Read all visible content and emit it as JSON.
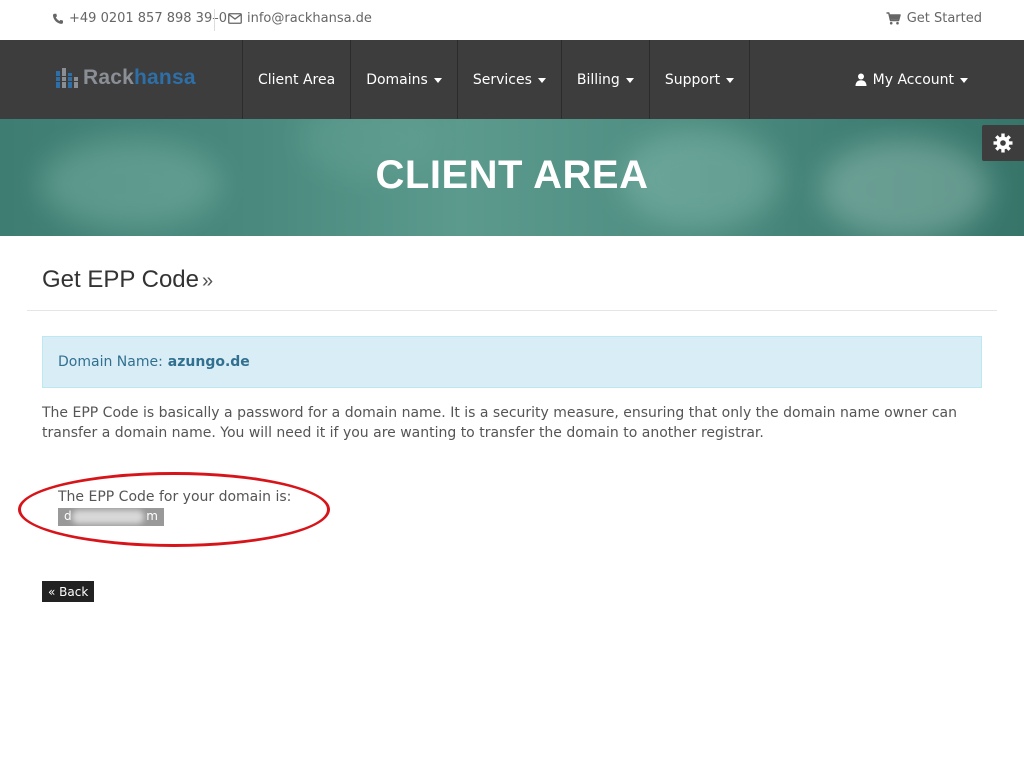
{
  "topbar": {
    "phone": "+49 0201 857 898 39–0",
    "email": "info@rackhansa.de",
    "get_started": "Get Started"
  },
  "logo": {
    "part1": "Rack",
    "part2": "hansa"
  },
  "nav": {
    "items": [
      {
        "label": "Client Area",
        "dropdown": false
      },
      {
        "label": "Domains",
        "dropdown": true
      },
      {
        "label": "Services",
        "dropdown": true
      },
      {
        "label": "Billing",
        "dropdown": true
      },
      {
        "label": "Support",
        "dropdown": true
      }
    ],
    "account": "My Account"
  },
  "hero": {
    "title": "CLIENT AREA"
  },
  "page": {
    "title": "Get EPP Code",
    "title_suffix": "»",
    "alert_label": "Domain Name:",
    "alert_value": "azungo.de",
    "description": "The EPP Code is basically a password for a domain name. It is a security measure, ensuring that only the domain name owner can transfer a domain name. You will need it if you are wanting to transfer the domain to another registrar.",
    "epp_label": "The EPP Code for your domain is:",
    "epp_code_start": "d",
    "epp_code_end": "m",
    "back_label": "« Back"
  },
  "colors": {
    "navbar": "#3d3d3d",
    "hero": "#4a8a7e",
    "alert_bg": "#d9edf7",
    "alert_text": "#31708f",
    "highlight_ellipse": "#d7141a",
    "logo_blue": "#2e6fa8"
  }
}
